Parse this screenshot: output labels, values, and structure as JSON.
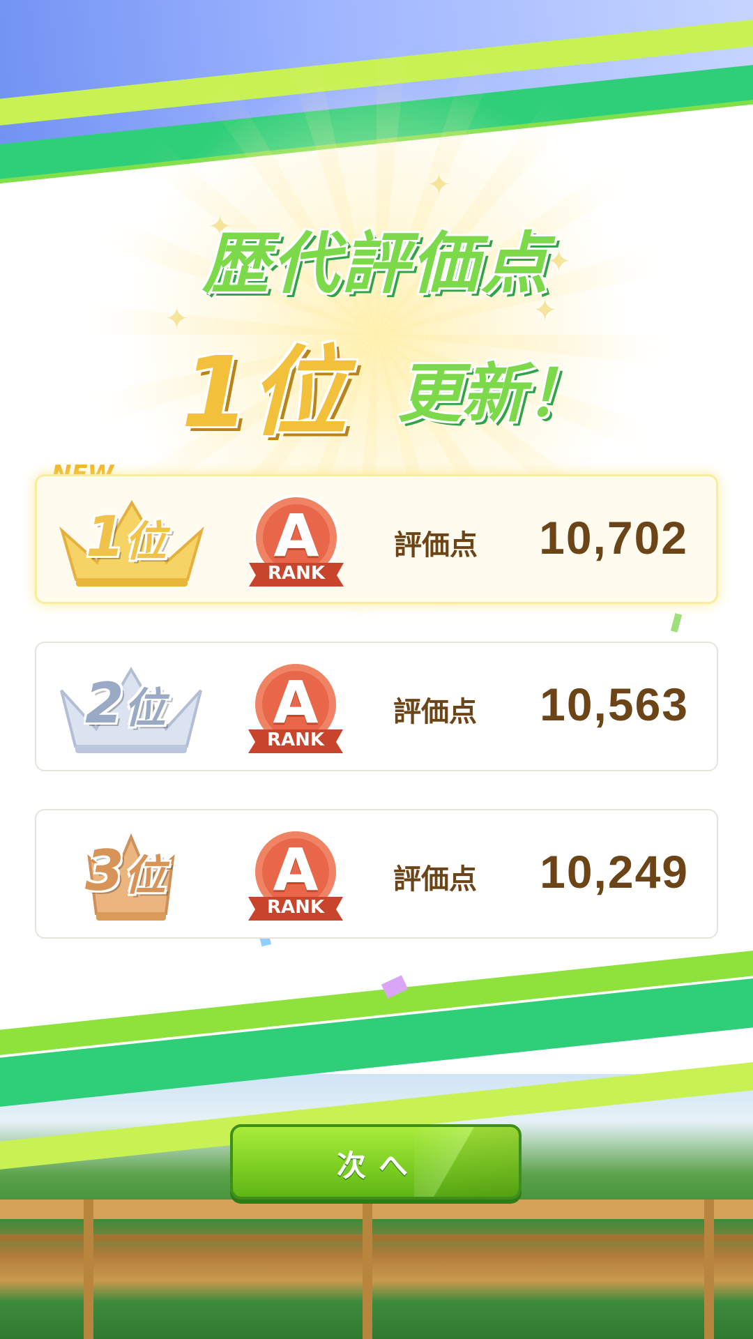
{
  "headline": {
    "title": "歴代評価点",
    "rank": "1位",
    "update": "更新！"
  },
  "new_tag": "NEW",
  "ranks": [
    {
      "place": "1",
      "place_suffix": "位",
      "grade": "A",
      "grade_label": "RANK",
      "score_label": "評価点",
      "score": "10,702",
      "crown_color": "#f2c03a"
    },
    {
      "place": "2",
      "place_suffix": "位",
      "grade": "A",
      "grade_label": "RANK",
      "score_label": "評価点",
      "score": "10,563",
      "crown_color": "#b9c6dd"
    },
    {
      "place": "3",
      "place_suffix": "位",
      "grade": "A",
      "grade_label": "RANK",
      "score_label": "評価点",
      "score": "10,249",
      "crown_color": "#d99a5a"
    }
  ],
  "next_button": {
    "label": "次へ"
  },
  "colors": {
    "accent_green": "#7cd94a",
    "score_brown": "#6b4417",
    "badge_orange": "#e8674a"
  }
}
